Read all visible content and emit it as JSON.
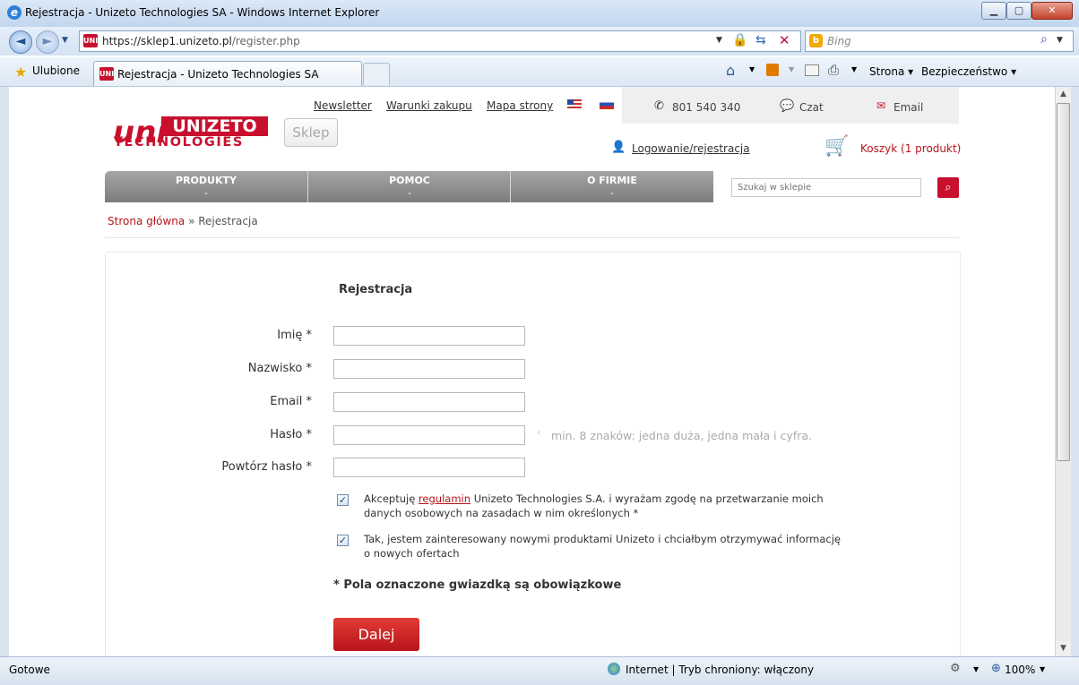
{
  "window": {
    "title": "Rejestracja - Unizeto Technologies SA - Windows Internet Explorer",
    "url_main": "https://sklep1.unizeto.pl",
    "url_path": "/register.php",
    "search_placeholder": "Bing",
    "favorites_label": "Ulubione",
    "tab_label": "Rejestracja - Unizeto Technologies SA",
    "favicon_text": "UNI",
    "menu_page": "Strona",
    "menu_security": "Bezpieczeństwo",
    "status_text": "Gotowe",
    "status_zone": "Internet | Tryb chroniony: włączony",
    "zoom": "100%"
  },
  "header": {
    "links": [
      "Newsletter",
      "Warunki zakupu",
      "Mapa strony"
    ],
    "phone": "801 540 340",
    "chat": "Czat",
    "email": "Email",
    "logo_mark": "uni",
    "logo_top": "UNIZETO",
    "logo_bottom": "TECHNOLOGIES",
    "shop_button": "Sklep",
    "login_link": "Logowanie/rejestracja",
    "cart_link": "Koszyk (1 produkt)",
    "nav": [
      "PRODUKTY",
      "POMOC",
      "O FIRMIE"
    ],
    "search_placeholder": "Szukaj w sklepie"
  },
  "breadcrumb": {
    "home": "Strona główna",
    "sep": "»",
    "current": "Rejestracja"
  },
  "form": {
    "title": "Rejestracja",
    "fields": [
      {
        "label": "Imię",
        "value": ""
      },
      {
        "label": "Nazwisko",
        "value": ""
      },
      {
        "label": "Email",
        "value": ""
      },
      {
        "label": "Hasło",
        "value": ""
      },
      {
        "label": "Powtórz hasło",
        "value": ""
      }
    ],
    "required_mark": "*",
    "password_hint": "min. 8 znaków: jedna duża, jedna mała i cyfra.",
    "consent_pre": "Akceptuję",
    "consent_link": "regulamin",
    "consent_post": "Unizeto Technologies S.A. i wyrażam zgodę na przetwarzanie moich danych osobowych na zasadach w nim określonych *",
    "consent_checked": true,
    "newsletter_text": "Tak, jestem zainteresowany nowymi produktami Unizeto i chciałbym otrzymywać informację o nowych ofertach",
    "newsletter_checked": true,
    "required_note": "* Pola oznaczone gwiazdką są obowiązkowe",
    "submit": "Dalej"
  }
}
